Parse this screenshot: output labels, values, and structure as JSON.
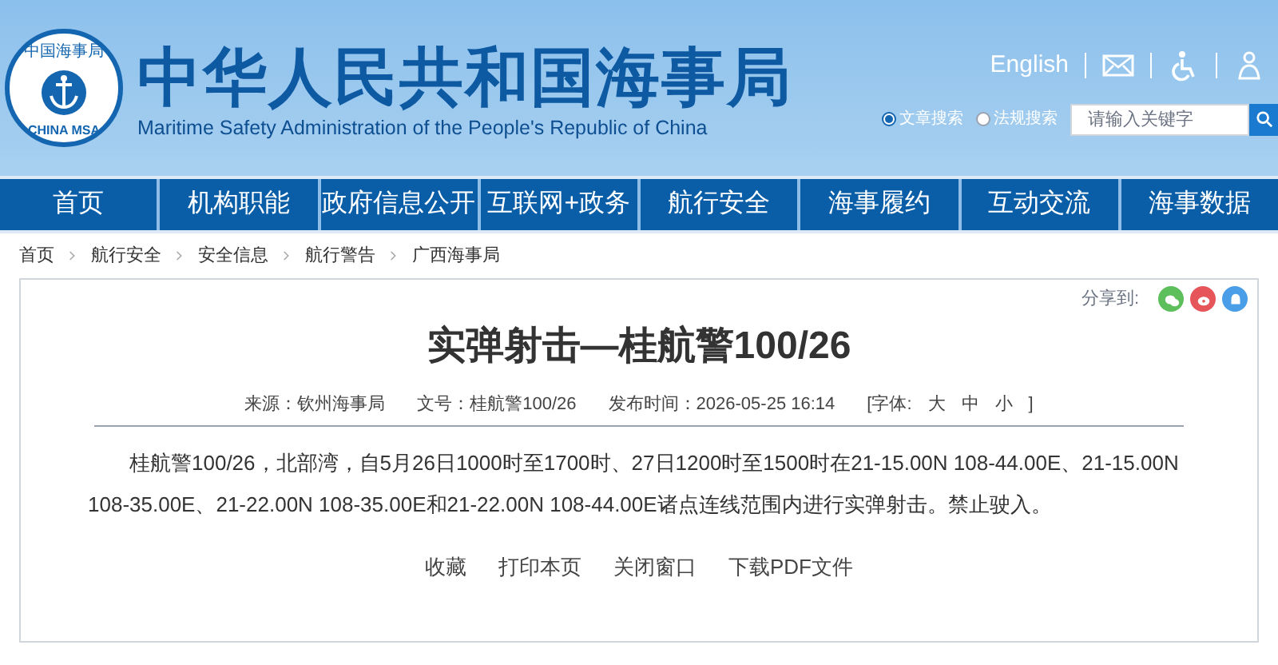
{
  "header": {
    "logo": {
      "top_text": "中国海事局",
      "bottom_text": "CHINA MSA"
    },
    "site_title": "中华人民共和国海事局",
    "site_subtitle": "Maritime Safety Administration of the People's Republic of China",
    "language_link": "English",
    "search": {
      "options": [
        {
          "label": "文章搜索",
          "selected": true
        },
        {
          "label": "法规搜索",
          "selected": false
        }
      ],
      "placeholder": "请输入关键字"
    }
  },
  "nav": [
    "首页",
    "机构职能",
    "政府信息公开",
    "互联网+政务",
    "航行安全",
    "海事履约",
    "互动交流",
    "海事数据"
  ],
  "breadcrumb": [
    "首页",
    "航行安全",
    "安全信息",
    "航行警告",
    "广西海事局"
  ],
  "share": {
    "label": "分享到:",
    "targets": [
      {
        "kind": "wechat",
        "color": "#5cbf5c"
      },
      {
        "kind": "weibo",
        "color": "#e5555a"
      },
      {
        "kind": "qq",
        "color": "#4a9ee8"
      }
    ]
  },
  "article": {
    "title": "实弹射击—桂航警100/26",
    "meta": [
      "来源：钦州海事局",
      "文号：桂航警100/26",
      "发布时间：2026-05-25 16:14"
    ],
    "font_size": {
      "label": "[字体:",
      "options": [
        "大",
        "中",
        "小"
      ],
      "close": "]"
    },
    "body": "桂航警100/26，北部湾，自5月26日1000时至1700时、27日1200时至1500时在21-15.00N 108-44.00E、21-15.00N 108-35.00E、21-22.00N 108-35.00E和21-22.00N 108-44.00E诸点连线范围内进行实弹射击。禁止驶入。",
    "actions": [
      "收藏",
      "打印本页",
      "关闭窗口",
      "下载PDF文件"
    ]
  }
}
